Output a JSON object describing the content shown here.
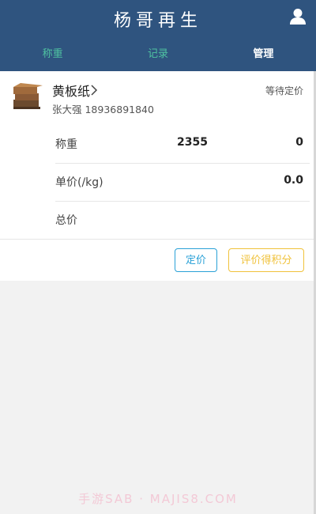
{
  "header": {
    "title": "杨哥再生",
    "tabs": [
      {
        "label": "称重",
        "state": "inactive"
      },
      {
        "label": "记录",
        "state": "inactive"
      },
      {
        "label": "管理",
        "state": "active"
      }
    ],
    "colors": {
      "bar": "#2f547f",
      "tab_inactive": "#4fc3a1",
      "tab_active": "#ffffff"
    }
  },
  "order": {
    "product_name": "黄板纸",
    "status": "等待定价",
    "contact": "张大强 18936891840",
    "rows": [
      {
        "label": "称重",
        "mid": "2355",
        "value": "0"
      },
      {
        "label": "单价(/kg)",
        "mid": "",
        "value": "0.0"
      },
      {
        "label": "总价",
        "mid": "",
        "value": ""
      }
    ],
    "buttons": {
      "price": "定价",
      "rate": "评价得积分"
    }
  },
  "watermark": "手游SAB · MAJIS8.COM"
}
